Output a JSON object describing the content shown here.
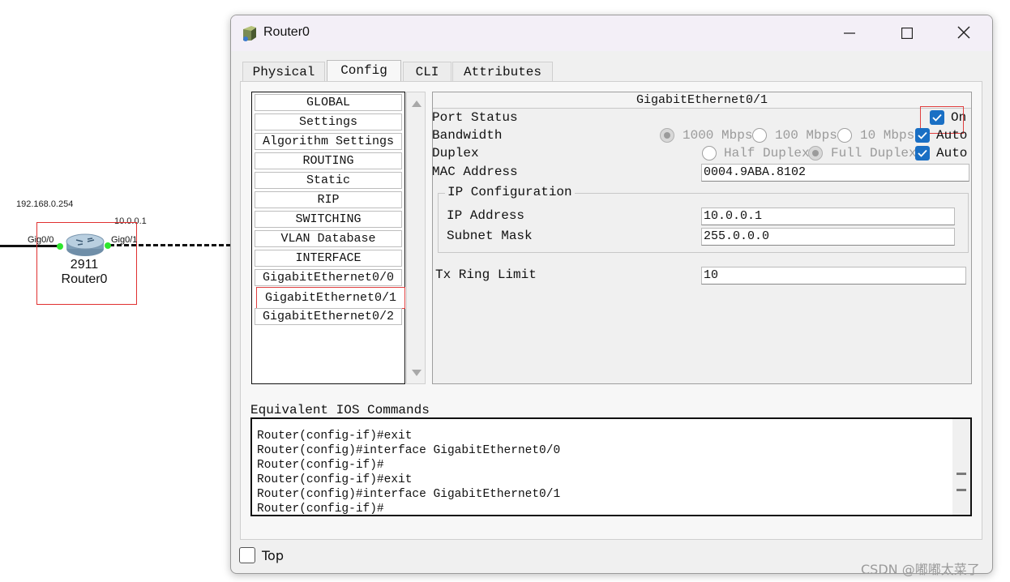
{
  "topology": {
    "left_ip": "192.168.0.254",
    "right_ip": "10.0.0.1",
    "port_left": "Gig0/0",
    "port_right": "Gig0/1",
    "model": "2911",
    "name": "Router0"
  },
  "window": {
    "title": "Router0",
    "minimize_icon": "minimize-icon",
    "maximize_icon": "maximize-icon",
    "close_icon": "close-icon"
  },
  "tabs": [
    {
      "label": "Physical"
    },
    {
      "label": "Config"
    },
    {
      "label": "CLI"
    },
    {
      "label": "Attributes"
    }
  ],
  "active_tab": "Config",
  "nav": {
    "items": [
      {
        "label": "GLOBAL"
      },
      {
        "label": "Settings"
      },
      {
        "label": "Algorithm Settings"
      },
      {
        "label": "ROUTING"
      },
      {
        "label": "Static"
      },
      {
        "label": "RIP"
      },
      {
        "label": "SWITCHING"
      },
      {
        "label": "VLAN Database"
      },
      {
        "label": "INTERFACE"
      },
      {
        "label": "GigabitEthernet0/0"
      },
      {
        "label": "GigabitEthernet0/1"
      },
      {
        "label": "GigabitEthernet0/2"
      }
    ],
    "selected": "GigabitEthernet0/1"
  },
  "interface": {
    "header": "GigabitEthernet0/1",
    "port_status_label": "Port Status",
    "port_on_label": "On",
    "port_on": true,
    "bandwidth_label": "Bandwidth",
    "bandwidth_options": [
      "1000 Mbps",
      "100 Mbps",
      "10 Mbps"
    ],
    "bandwidth_auto_label": "Auto",
    "bandwidth_auto": true,
    "duplex_label": "Duplex",
    "duplex_options": [
      "Half Duplex",
      "Full Duplex"
    ],
    "duplex_auto_label": "Auto",
    "duplex_auto": true,
    "mac_label": "MAC Address",
    "mac_value": "0004.9ABA.8102",
    "ip_group_title": "IP Configuration",
    "ip_label": "IP Address",
    "ip_value": "10.0.0.1",
    "mask_label": "Subnet Mask",
    "mask_value": "255.0.0.0",
    "tx_label": "Tx Ring Limit",
    "tx_value": "10"
  },
  "ios": {
    "title": "Equivalent IOS Commands",
    "lines": [
      "Router(config-if)#exit",
      "Router(config)#interface GigabitEthernet0/0",
      "Router(config-if)#",
      "Router(config-if)#exit",
      "Router(config)#interface GigabitEthernet0/1",
      "Router(config-if)#"
    ]
  },
  "footer": {
    "top_label": "Top",
    "top_checked": false
  },
  "watermark": "CSDN @嘟嘟太菜了",
  "colors": {
    "accent_check": "#1a6fc4",
    "selection_red": "#e04040",
    "port_green": "#2ee62e"
  }
}
